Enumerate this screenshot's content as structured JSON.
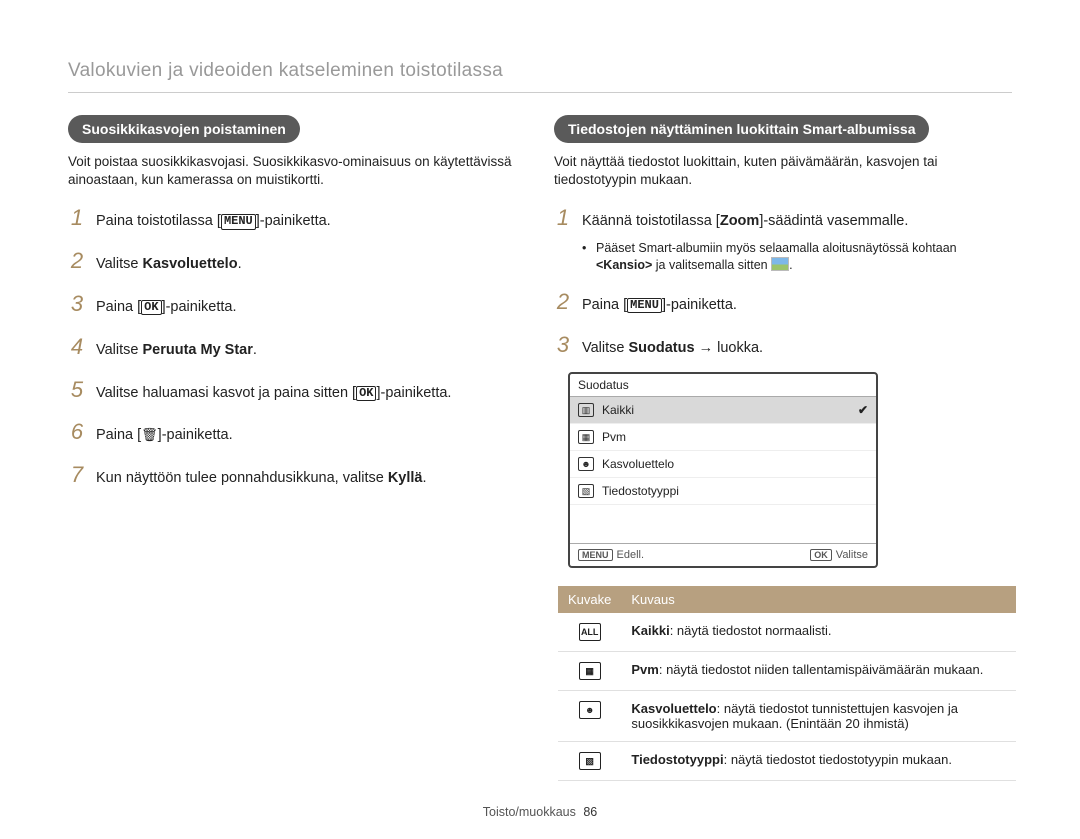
{
  "header": {
    "title": "Valokuvien ja videoiden katseleminen toistotilassa"
  },
  "footer": {
    "section": "Toisto/muokkaus",
    "page": "86"
  },
  "left": {
    "section_title": "Suosikkikasvojen poistaminen",
    "intro": "Voit poistaa suosikkikasvojasi. Suosikkikasvo-ominaisuus on käytettävissä ainoastaan, kun kamerassa on muistikortti.",
    "steps": [
      {
        "num": "1",
        "pre": "Paina toistotilassa [",
        "icon": "MENU",
        "post": "]-painiketta."
      },
      {
        "num": "2",
        "pre": "Valitse ",
        "bold": "Kasvoluettelo",
        "post": "."
      },
      {
        "num": "3",
        "pre": "Paina [",
        "icon": "OK",
        "post": "]-painiketta."
      },
      {
        "num": "4",
        "pre": "Valitse ",
        "bold": "Peruuta My Star",
        "post": "."
      },
      {
        "num": "5",
        "pre": "Valitse haluamasi kasvot ja paina sitten [",
        "icon": "OK",
        "post": "]-painiketta."
      },
      {
        "num": "6",
        "pre": "Paina [",
        "trash": true,
        "post": "]-painiketta."
      },
      {
        "num": "7",
        "pre": "Kun näyttöön tulee ponnahdusikkuna, valitse ",
        "bold": "Kyllä",
        "post": "."
      }
    ]
  },
  "right": {
    "section_title": "Tiedostojen näyttäminen luokittain Smart-albumissa",
    "intro": "Voit näyttää tiedostot luokittain, kuten päivämäärän, kasvojen tai tiedostotyypin mukaan.",
    "steps": [
      {
        "num": "1",
        "pre": "Käännä toistotilassa [",
        "bold": "Zoom",
        "post": "]-säädintä vasemmalle.",
        "bullet": {
          "pre": "Pääset Smart-albumiin myös selaamalla aloitusnäytössä kohtaan ",
          "angle": "<Kansio>",
          "post": " ja valitsemalla sitten "
        }
      },
      {
        "num": "2",
        "pre": "Paina [",
        "icon": "MENU",
        "post": "]-painiketta."
      },
      {
        "num": "3",
        "pre": "Valitse ",
        "bold": "Suodatus",
        "arrow": " → ",
        "post": "luokka."
      }
    ],
    "screen": {
      "title": "Suodatus",
      "items": [
        {
          "label": "Kaikki",
          "selected": true
        },
        {
          "label": "Pvm"
        },
        {
          "label": "Kasvoluettelo"
        },
        {
          "label": "Tiedostotyyppi"
        }
      ],
      "footer_left_icon": "MENU",
      "footer_left": "Edell.",
      "footer_right_icon": "OK",
      "footer_right": "Valitse"
    },
    "table": {
      "headers": {
        "icon": "Kuvake",
        "desc": "Kuvaus"
      },
      "rows": [
        {
          "iconName": "all-icon",
          "bold": "Kaikki",
          "text": ": näytä tiedostot normaalisti."
        },
        {
          "iconName": "date-icon",
          "bold": "Pvm",
          "text": ": näytä tiedostot niiden tallentamispäivämäärän mukaan."
        },
        {
          "iconName": "face-icon",
          "bold": "Kasvoluettelo",
          "text": ": näytä tiedostot tunnistettujen kasvojen ja suosikkikasvojen mukaan. (Enintään 20 ihmistä)"
        },
        {
          "iconName": "filetype-icon",
          "bold": "Tiedostotyyppi",
          "text": ": näytä tiedostot tiedostotyypin mukaan."
        }
      ]
    }
  }
}
